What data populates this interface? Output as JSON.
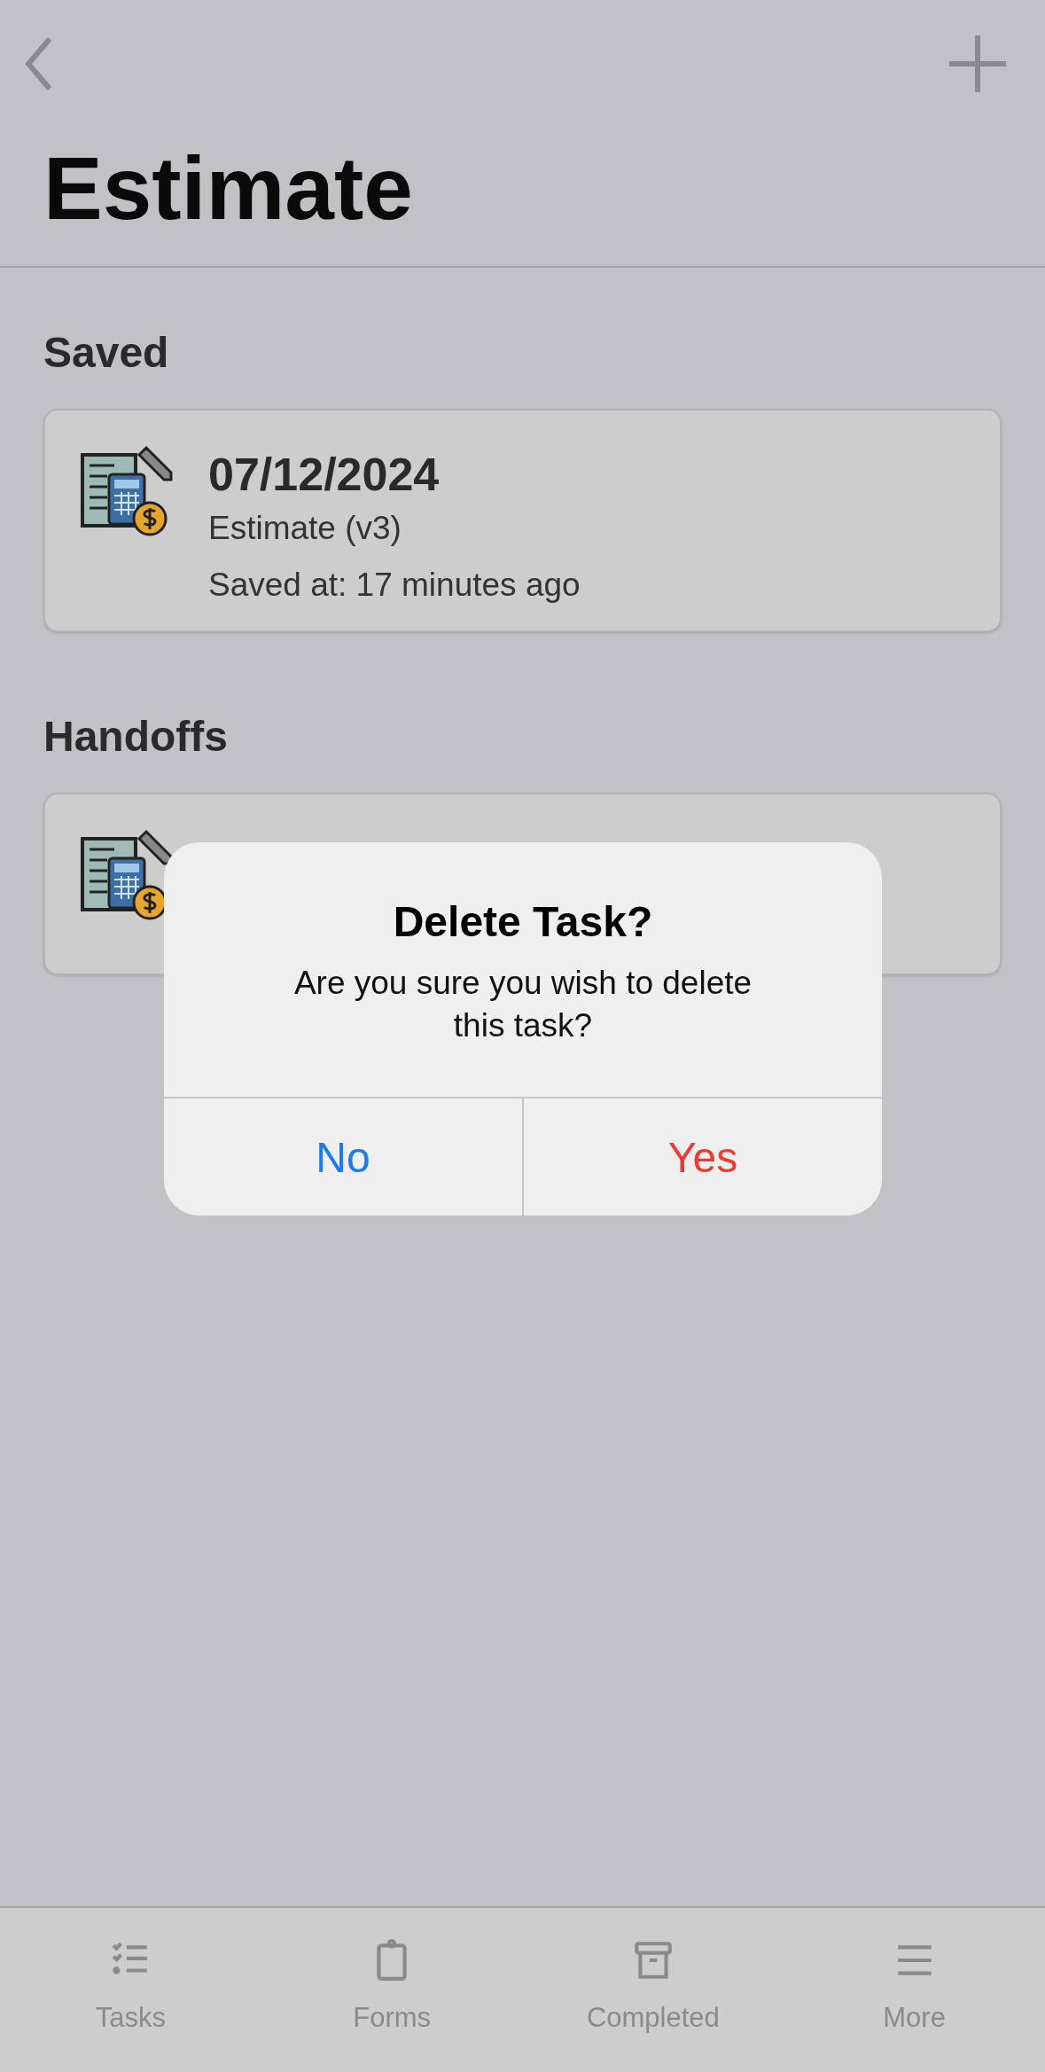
{
  "header": {
    "title": "Estimate"
  },
  "sections": [
    {
      "heading": "Saved",
      "cards": [
        {
          "date": "07/12/2024",
          "name": "Estimate (v3)",
          "saved": "Saved at: 17 minutes ago"
        }
      ]
    },
    {
      "heading": "Handoffs",
      "cards": [
        {
          "kind": "covered"
        }
      ]
    }
  ],
  "dialog": {
    "title": "Delete Task?",
    "message": "Are you sure you wish to delete this task?",
    "buttons": [
      {
        "label": "No",
        "kind": "cancel"
      },
      {
        "label": "Yes",
        "kind": "destructive"
      }
    ]
  },
  "tabs": [
    {
      "label": "Tasks",
      "kind": "checklist"
    },
    {
      "label": "Forms",
      "kind": "clipboard"
    },
    {
      "label": "Completed",
      "kind": "archive"
    },
    {
      "label": "More",
      "kind": "menu"
    }
  ]
}
